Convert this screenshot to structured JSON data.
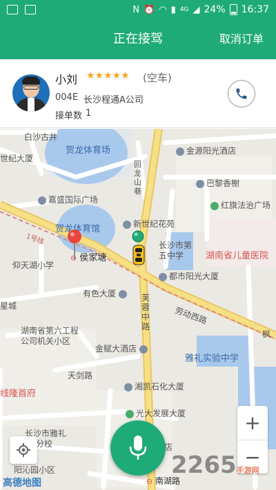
{
  "status_bar": {
    "network": "4G",
    "battery": "24%",
    "time": "16:37"
  },
  "header": {
    "title": "正在接驾",
    "cancel_label": "取消订单"
  },
  "driver": {
    "name": "小刘",
    "stars": "★★★★★",
    "status": "(空车)",
    "plate": "004E",
    "company": "长沙程通A公司",
    "order_count_label": "接单数",
    "order_count": "1"
  },
  "map": {
    "labels": {
      "baisha": "白沙古井",
      "helong_stadium_top": "贺龙体育场",
      "jinyuan_hotel": "金源阳光酒店",
      "shiji_mansion": "世纪大厦",
      "huilong_lane": "回龙山巷",
      "paris_tree": "巴黎香榭",
      "jiasheng": "嘉盛国际广场",
      "hongqi": "红旗法治广场",
      "helong_gym": "贺龙体育馆",
      "xinshiji": "新世纪花苑",
      "yihao_line": "1号线",
      "changsha_no5": "长沙市第五中学",
      "children_hospital": "湖南省儿童医院",
      "houjiatang": "侯家塘",
      "yangtianhu": "仰天湖小学",
      "yangguang": "都市阳光大厦",
      "youse": "有色大厦",
      "furong_road": "芙蓉中路",
      "laodong_road": "劳动西路",
      "xingcheng": "星城",
      "sixth_eng": "湖南省第六工程公司机关小区",
      "jinfu_hotel": "金赋大酒店",
      "yali_school": "雅礼实验中学",
      "tianjian_road": "天剑路",
      "xianghu": "湘凯石化大厦",
      "ershou": "线隆首府",
      "guangda": "光大发展大厦",
      "yali_branch": "长沙市雅礼",
      "yali_branch_2": "雅礼分校",
      "yangqin": "阳沁园小区",
      "nanhu_road": "南湖路",
      "feng": "枫",
      "hotel_partial": "店"
    }
  },
  "controls": {
    "zoom_in": "+",
    "zoom_out": "−"
  },
  "footer": {
    "amap_logo": "高德地图",
    "watermark": "2265",
    "watermark_sub": "手游网"
  },
  "colors": {
    "brand": "#1fab78",
    "star": "#f5a623",
    "road_major": "#f5d777",
    "water": "#a9c9ec"
  }
}
